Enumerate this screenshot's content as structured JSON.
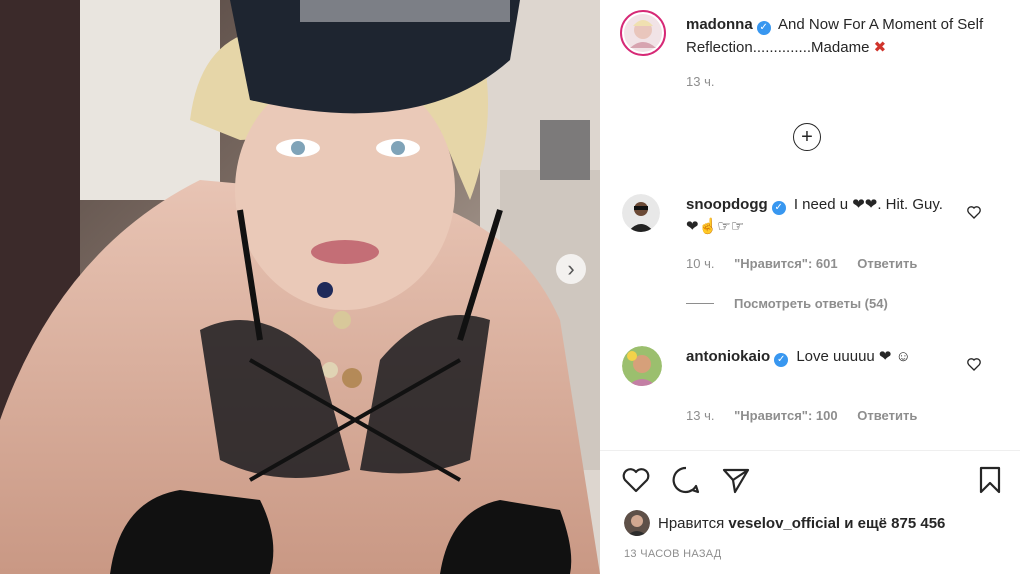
{
  "post": {
    "author": "madonna",
    "caption": "And Now For A Moment of Self Reflection..............Madame",
    "caption_emoji": "✖",
    "time": "13 ч."
  },
  "icons": {
    "verified": "verified-badge",
    "load_more": "plus-circle-icon",
    "next": "chevron-right-icon",
    "like": "heart-icon",
    "comment": "comment-icon",
    "share": "paper-plane-icon",
    "save": "bookmark-icon"
  },
  "load_more_symbol": "+",
  "next_symbol": "›",
  "comments": [
    {
      "user": "snoopdogg",
      "text": "I need u ❤❤. Hit. Guy. ❤☝☞☞",
      "time": "10 ч.",
      "likes": "\"Нравится\": 601",
      "reply": "Ответить"
    },
    {
      "user": "antoniokaio",
      "text": "Love uuuuu ❤ ☺",
      "time": "13 ч.",
      "likes": "\"Нравится\": 100",
      "reply": "Ответить"
    }
  ],
  "view_replies": "Посмотреть ответы (54)",
  "likes_line": {
    "prefix": "Нравится",
    "user": "veselov_official",
    "suffix": "и ещё 875 456"
  },
  "posted_ago": "13 ЧАСОВ НАЗАД",
  "colors": {
    "verified": "#3897f0",
    "text": "#262626",
    "secondary": "#8e8e8e"
  }
}
